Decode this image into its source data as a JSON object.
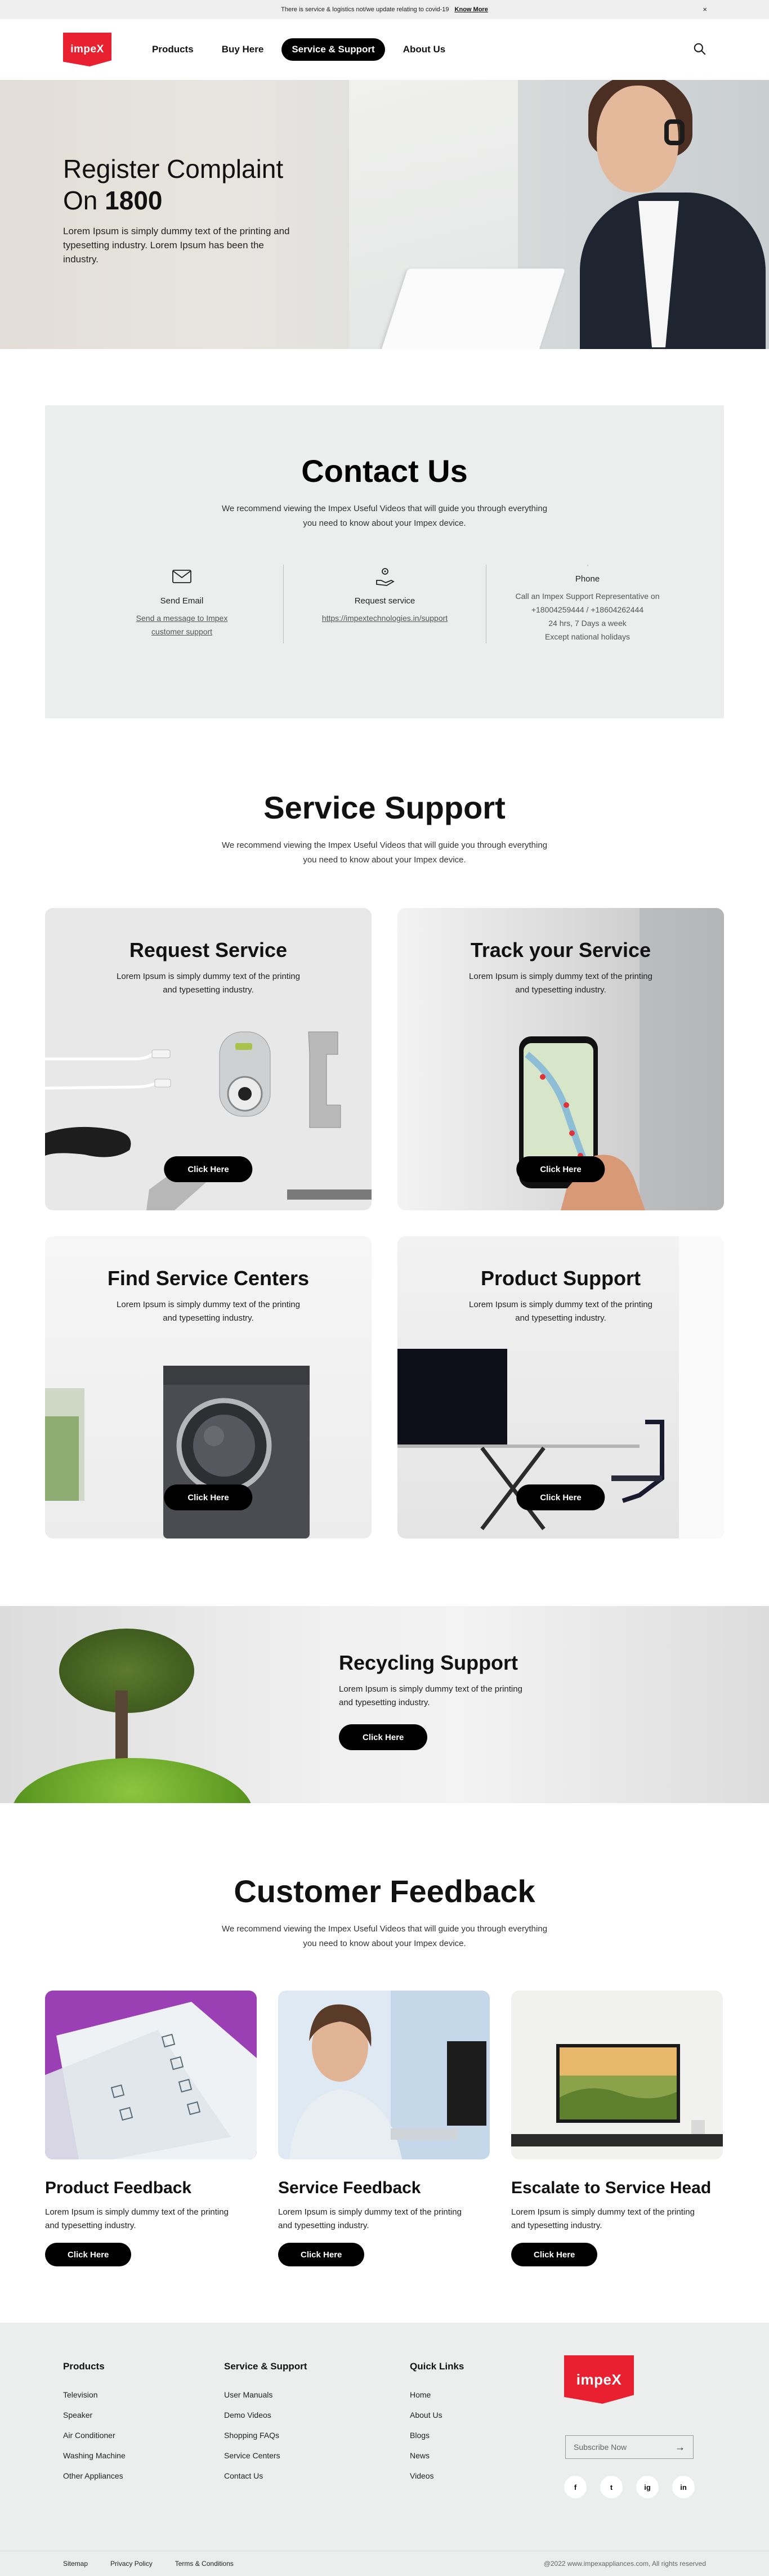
{
  "topbar": {
    "message": "There is service & logistics not/we update relating to covid-19",
    "link": "Know More",
    "close": "×"
  },
  "header": {
    "logo": "impeX",
    "nav": [
      "Products",
      "Buy Here",
      "Service & Support",
      "About Us"
    ],
    "active_nav": "Service & Support"
  },
  "hero": {
    "title_line1": "Register Complaint",
    "title_prefix": "On",
    "title_number": "1800",
    "body": "Lorem Ipsum is simply dummy text of the printing and typesetting industry. Lorem Ipsum has been the industry."
  },
  "contact": {
    "title": "Contact Us",
    "subtitle_line1": "We recommend viewing the Impex Useful Videos that will guide you through everything",
    "subtitle_line2": "you need to know about your Impex device.",
    "columns": [
      {
        "icon": "mail-icon",
        "title": "Send Email",
        "lines": [
          "Send a message to Impex",
          "customer support"
        ]
      },
      {
        "icon": "service-hand-icon",
        "title": "Request service",
        "lines": [
          "https://impextechnologies.in/support"
        ]
      },
      {
        "icon": "phone-icon",
        "title": "Phone",
        "lines": [
          "Call an Impex Support Representative on",
          "+18004259444 / +18604262444",
          "24 hrs, 7 Days a week",
          "Except national holidays"
        ]
      }
    ]
  },
  "service_support": {
    "title": "Service Support",
    "subtitle_line1": "We recommend viewing the Impex Useful Videos that will guide you through everything",
    "subtitle_line2": "you need to know about your Impex device.",
    "cards": [
      {
        "title": "Request Service",
        "line1": "Lorem Ipsum is simply dummy text of the printing",
        "line2": "and typesetting industry.",
        "cta": "Click Here"
      },
      {
        "title": "Track your Service",
        "line1": "Lorem Ipsum is simply dummy text of the printing",
        "line2": "and typesetting industry.",
        "cta": "Click Here"
      },
      {
        "title": "Find Service Centers",
        "line1": "Lorem Ipsum is simply dummy text of the printing",
        "line2": "and typesetting industry.",
        "cta": "Click Here"
      },
      {
        "title": "Product Support",
        "line1": "Lorem Ipsum is simply dummy text of the printing",
        "line2": "and typesetting industry.",
        "cta": "Click Here"
      }
    ]
  },
  "recycling": {
    "title": "Recycling Support",
    "line1": "Lorem Ipsum is simply dummy text of the printing",
    "line2": "and typesetting industry.",
    "cta": "Click Here"
  },
  "feedback": {
    "title": "Customer Feedback",
    "subtitle_line1": "We recommend viewing the Impex Useful Videos that will guide you through everything",
    "subtitle_line2": "you need to know about your Impex device.",
    "cards": [
      {
        "title": "Product Feedback",
        "line1": "Lorem Ipsum is simply dummy text of the printing",
        "line2": "and typesetting industry.",
        "cta": "Click Here"
      },
      {
        "title": "Service Feedback",
        "line1": "Lorem Ipsum is simply dummy text of the printing",
        "line2": "and typesetting industry.",
        "cta": "Click Here"
      },
      {
        "title": "Escalate to Service Head",
        "line1": "Lorem Ipsum is simply dummy text of the printing",
        "line2": "and typesetting industry.",
        "cta": "Click Here"
      }
    ]
  },
  "footer": {
    "products": {
      "title": "Products",
      "items": [
        "Television",
        "Speaker",
        "Air Conditioner",
        "Washing Machine",
        "Other Appliances"
      ]
    },
    "service": {
      "title": "Service & Support",
      "items": [
        "User Manuals",
        "Demo Videos",
        "Shopping FAQs",
        "Service Centers",
        "Contact Us"
      ]
    },
    "quick": {
      "title": "Quick Links",
      "items": [
        "Home",
        "About Us",
        "Blogs",
        "News",
        "Videos"
      ]
    },
    "logo": "impeX",
    "subscribe_placeholder": "Subscribe Now",
    "social": [
      "f",
      "t",
      "ig",
      "in"
    ],
    "bottom_links": [
      "Sitemap",
      "Privacy Policy",
      "Terms & Conditions"
    ],
    "copyright": "@2022 www.impexappliances.com, All rights reserved"
  }
}
